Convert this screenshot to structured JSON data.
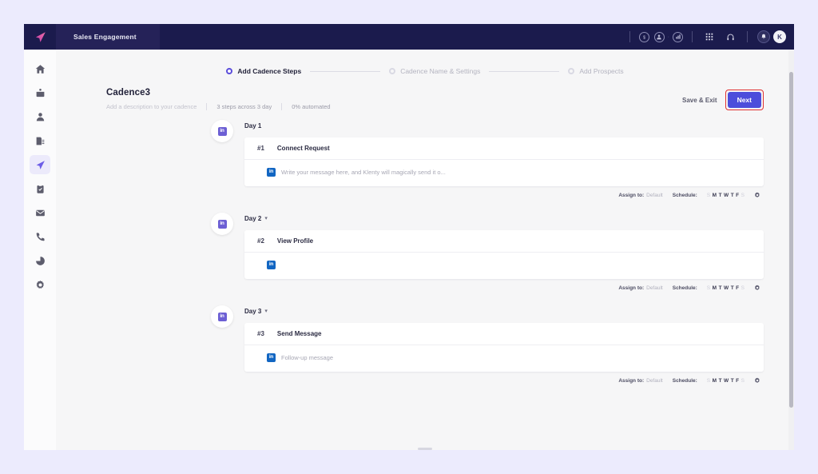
{
  "app": {
    "logo_icon": "paper-plane-logo",
    "nav_tab": "Sales Engagement",
    "header_icons": [
      {
        "name": "dollar-circle-icon",
        "glyph": "$"
      },
      {
        "name": "person-circle-icon",
        "glyph": "●"
      },
      {
        "name": "chart-circle-icon",
        "glyph": "▐"
      }
    ],
    "apps_icon": "grid-apps-icon",
    "support_icon": "headset-icon",
    "notification_icon": "bell-icon",
    "avatar_initial": "K"
  },
  "sidebar": {
    "items": [
      {
        "name": "sidebar-item-home",
        "icon": "home-icon",
        "active": false
      },
      {
        "name": "sidebar-item-inbox",
        "icon": "inbox-icon",
        "active": false
      },
      {
        "name": "sidebar-item-prospects",
        "icon": "person-icon",
        "active": false
      },
      {
        "name": "sidebar-item-reports",
        "icon": "report-icon",
        "active": false
      },
      {
        "name": "sidebar-item-cadence",
        "icon": "paper-plane-icon",
        "active": true
      },
      {
        "name": "sidebar-item-tasks",
        "icon": "clipboard-icon",
        "active": false
      },
      {
        "name": "sidebar-item-email",
        "icon": "envelope-icon",
        "active": false
      },
      {
        "name": "sidebar-item-calls",
        "icon": "phone-icon",
        "active": false
      },
      {
        "name": "sidebar-item-analytics",
        "icon": "pie-chart-icon",
        "active": false
      },
      {
        "name": "sidebar-item-settings",
        "icon": "gear-icon",
        "active": false
      }
    ]
  },
  "stepper": {
    "steps": [
      {
        "label": "Add Cadence Steps",
        "active": true
      },
      {
        "label": "Cadence Name & Settings",
        "active": false
      },
      {
        "label": "Add Prospects",
        "active": false
      }
    ]
  },
  "cadence": {
    "title": "Cadence3",
    "description_placeholder": "Add a description to your cadence",
    "steps_summary": "3 steps across 3 day",
    "automated_summary": "0% automated",
    "save_exit_label": "Save & Exit",
    "next_label": "Next",
    "next_focus_color": "#e03131",
    "next_bg_color": "#4c4ddb"
  },
  "steps": [
    {
      "day_label": "Day 1",
      "has_chevron": false,
      "channel": "linkedin",
      "number": "#1",
      "name": "Connect Request",
      "message": "Write your message here, and Klenty will magically send it o...",
      "assign_label": "Assign to:",
      "assign_value": "Default",
      "schedule_label": "Schedule:",
      "schedule_days": [
        {
          "letter": "S",
          "on": false
        },
        {
          "letter": "M",
          "on": true
        },
        {
          "letter": "T",
          "on": true
        },
        {
          "letter": "W",
          "on": true
        },
        {
          "letter": "T",
          "on": true
        },
        {
          "letter": "F",
          "on": true
        },
        {
          "letter": "S",
          "on": false
        }
      ]
    },
    {
      "day_label": "Day 2",
      "has_chevron": true,
      "channel": "linkedin",
      "number": "#2",
      "name": "View Profile",
      "message": "",
      "assign_label": "Assign to:",
      "assign_value": "Default",
      "schedule_label": "Schedule:",
      "schedule_days": [
        {
          "letter": "S",
          "on": false
        },
        {
          "letter": "M",
          "on": true
        },
        {
          "letter": "T",
          "on": true
        },
        {
          "letter": "W",
          "on": true
        },
        {
          "letter": "T",
          "on": true
        },
        {
          "letter": "F",
          "on": true
        },
        {
          "letter": "S",
          "on": false
        }
      ]
    },
    {
      "day_label": "Day 3",
      "has_chevron": true,
      "channel": "linkedin",
      "number": "#3",
      "name": "Send Message",
      "message": "Follow-up message",
      "assign_label": "Assign to:",
      "assign_value": "Default",
      "schedule_label": "Schedule:",
      "schedule_days": [
        {
          "letter": "S",
          "on": false
        },
        {
          "letter": "M",
          "on": true
        },
        {
          "letter": "T",
          "on": true
        },
        {
          "letter": "W",
          "on": true
        },
        {
          "letter": "T",
          "on": true
        },
        {
          "letter": "F",
          "on": true
        },
        {
          "letter": "S",
          "on": false
        }
      ]
    }
  ],
  "linkedin_badge_text": "in"
}
